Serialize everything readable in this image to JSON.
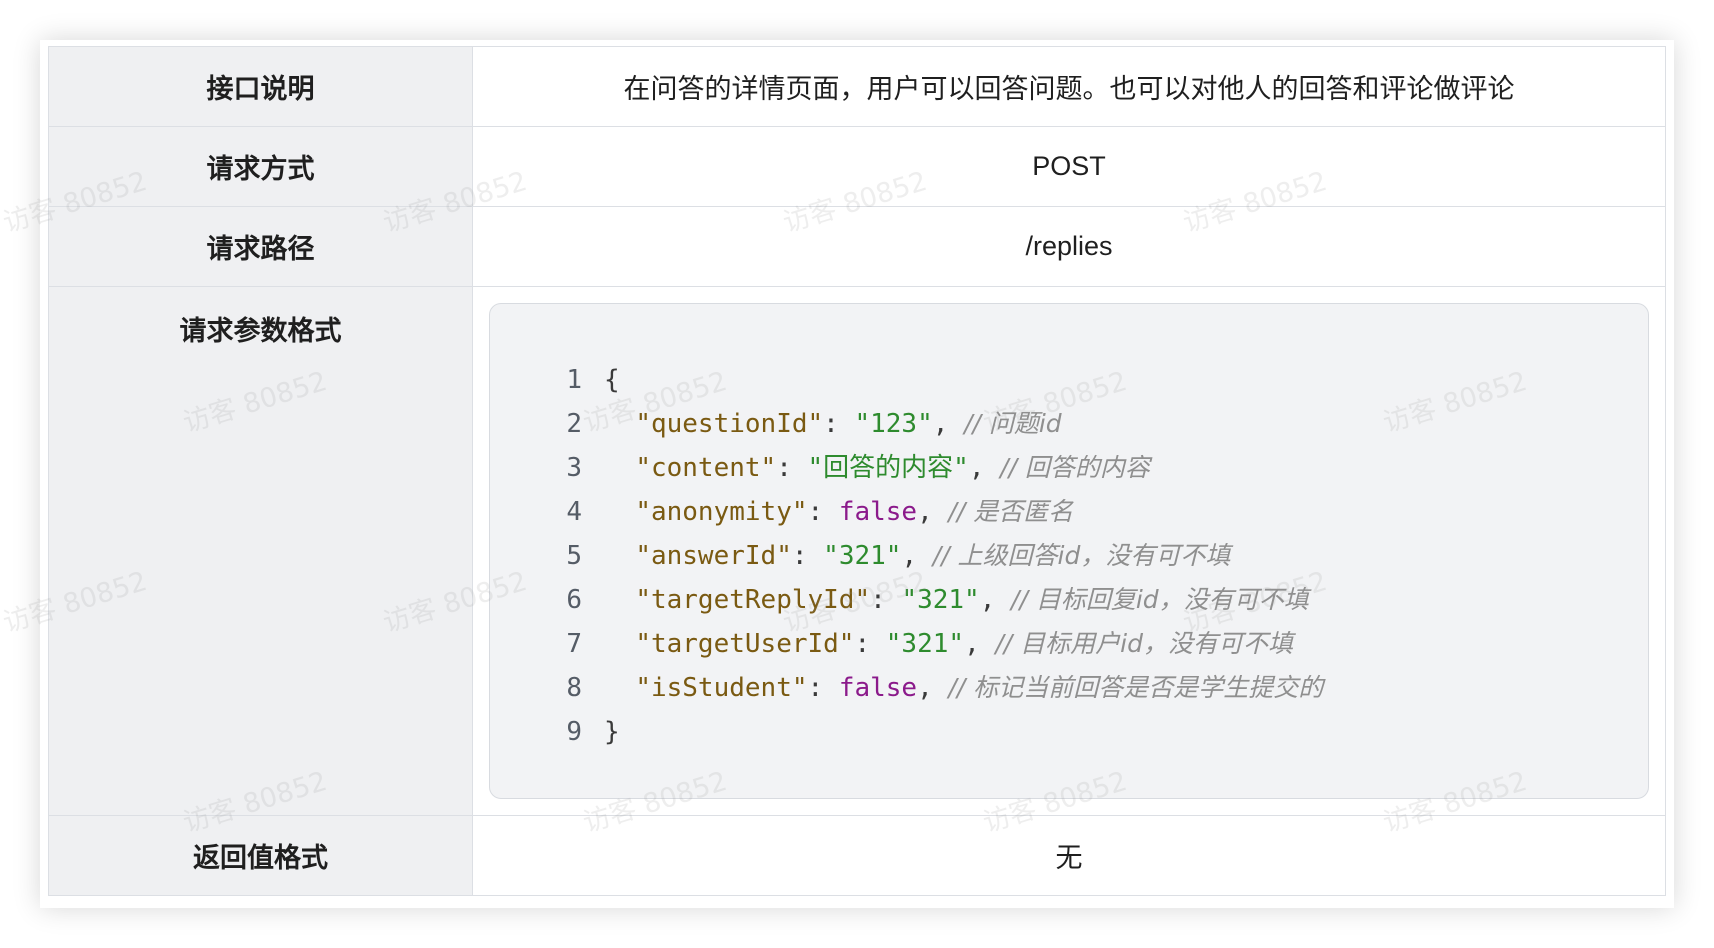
{
  "table": {
    "rows": [
      {
        "label": "接口说明",
        "value": "在问答的详情页面，用户可以回答问题。也可以对他人的回答和评论做评论"
      },
      {
        "label": "请求方式",
        "value": "POST"
      },
      {
        "label": "请求路径",
        "value": "/replies"
      },
      {
        "label": "请求参数格式"
      },
      {
        "label": "返回值格式",
        "value": "无"
      }
    ]
  },
  "code": {
    "lines": [
      {
        "no": "1",
        "tokens": [
          {
            "t": "{",
            "k": "punc"
          }
        ]
      },
      {
        "no": "2",
        "tokens": [
          {
            "t": "  ",
            "k": "punc"
          },
          {
            "t": "\"questionId\"",
            "k": "key"
          },
          {
            "t": ": ",
            "k": "punc"
          },
          {
            "t": "\"123\"",
            "k": "str"
          },
          {
            "t": ", ",
            "k": "punc"
          },
          {
            "t": "// 问题id",
            "k": "comment"
          }
        ]
      },
      {
        "no": "3",
        "tokens": [
          {
            "t": "  ",
            "k": "punc"
          },
          {
            "t": "\"content\"",
            "k": "key"
          },
          {
            "t": ": ",
            "k": "punc"
          },
          {
            "t": "\"回答的内容\"",
            "k": "str"
          },
          {
            "t": ", ",
            "k": "punc"
          },
          {
            "t": "// 回答的内容",
            "k": "comment"
          }
        ]
      },
      {
        "no": "4",
        "tokens": [
          {
            "t": "  ",
            "k": "punc"
          },
          {
            "t": "\"anonymity\"",
            "k": "key"
          },
          {
            "t": ": ",
            "k": "punc"
          },
          {
            "t": "false",
            "k": "bool"
          },
          {
            "t": ", ",
            "k": "punc"
          },
          {
            "t": "// 是否匿名",
            "k": "comment"
          }
        ]
      },
      {
        "no": "5",
        "tokens": [
          {
            "t": "  ",
            "k": "punc"
          },
          {
            "t": "\"answerId\"",
            "k": "key"
          },
          {
            "t": ": ",
            "k": "punc"
          },
          {
            "t": "\"321\"",
            "k": "str"
          },
          {
            "t": ", ",
            "k": "punc"
          },
          {
            "t": "// 上级回答id，没有可不填",
            "k": "comment"
          }
        ]
      },
      {
        "no": "6",
        "tokens": [
          {
            "t": "  ",
            "k": "punc"
          },
          {
            "t": "\"targetReplyId\"",
            "k": "key"
          },
          {
            "t": ": ",
            "k": "punc"
          },
          {
            "t": "\"321\"",
            "k": "str"
          },
          {
            "t": ", ",
            "k": "punc"
          },
          {
            "t": "// 目标回复id，没有可不填",
            "k": "comment"
          }
        ]
      },
      {
        "no": "7",
        "tokens": [
          {
            "t": "  ",
            "k": "punc"
          },
          {
            "t": "\"targetUserId\"",
            "k": "key"
          },
          {
            "t": ": ",
            "k": "punc"
          },
          {
            "t": "\"321\"",
            "k": "str"
          },
          {
            "t": ", ",
            "k": "punc"
          },
          {
            "t": "// 目标用户id，没有可不填",
            "k": "comment"
          }
        ]
      },
      {
        "no": "8",
        "tokens": [
          {
            "t": "  ",
            "k": "punc"
          },
          {
            "t": "\"isStudent\"",
            "k": "key"
          },
          {
            "t": ": ",
            "k": "punc"
          },
          {
            "t": "false",
            "k": "bool"
          },
          {
            "t": ", ",
            "k": "punc"
          },
          {
            "t": "// 标记当前回答是否是学生提交的",
            "k": "comment"
          }
        ]
      },
      {
        "no": "9",
        "tokens": [
          {
            "t": "}",
            "k": "punc"
          }
        ]
      }
    ]
  },
  "watermark": {
    "text": "访客 80852"
  }
}
